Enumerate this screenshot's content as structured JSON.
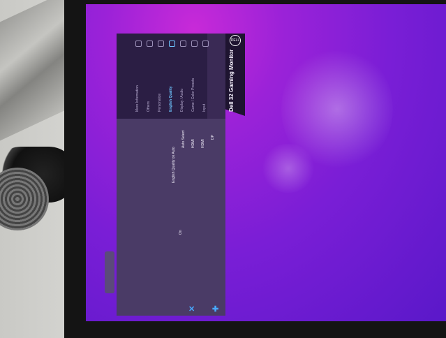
{
  "osd": {
    "title": "Dell 32 Gaming Monitor",
    "logo": "DELL",
    "menu_items": [
      {
        "label": "Input",
        "icon": "input-icon",
        "active": false
      },
      {
        "label": "Game / Color Presets",
        "icon": "palette-icon",
        "active": false
      },
      {
        "label": "Display / Audio",
        "icon": "display-icon",
        "active": false
      },
      {
        "label": "English Quality",
        "icon": "quality-icon",
        "active": true
      },
      {
        "label": "Personalize",
        "icon": "star-icon",
        "active": false
      },
      {
        "label": "Others",
        "icon": "others-icon",
        "active": false
      },
      {
        "label": "More Information",
        "icon": "info-icon",
        "active": false
      }
    ],
    "values": [
      {
        "label": "DP",
        "selected": true
      },
      {
        "label": "HDMI",
        "selected": false
      },
      {
        "label": "HDMI",
        "selected": false
      },
      {
        "label": "Auto Select",
        "selected": false
      },
      {
        "label": "English Quality on Auto",
        "selected": false
      },
      {
        "label": "On",
        "selected": true
      }
    ],
    "nav": {
      "close_glyph": "✕",
      "add_glyph": "✚"
    }
  },
  "colors": {
    "osd_bg": "#3a2a55",
    "accent": "#48a8ff",
    "screen": "#7a1ed6"
  }
}
